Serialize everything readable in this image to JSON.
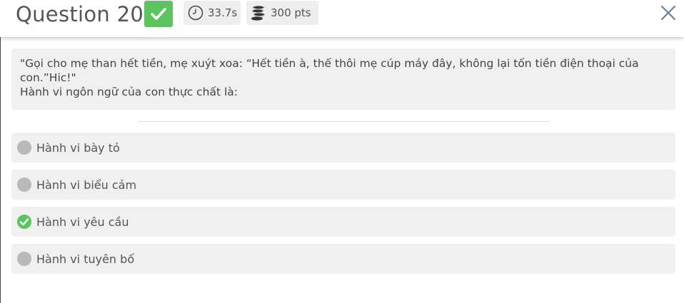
{
  "header": {
    "title": "Question 20",
    "timer": "33.7s",
    "points": "300 pts",
    "icons": {
      "status": "check-icon",
      "timer": "clock-icon",
      "points": "coins-icon",
      "close": "close-icon"
    },
    "accent_color": "#5cc45f"
  },
  "question": {
    "line1": "\"Gọi cho mẹ than hết tiền, mẹ xuýt xoa: “Hết tiền à, thế thôi mẹ cúp máy đây, không lại tốn tiền điện thoại của con.”Hic!\"",
    "line2": "Hành vi ngôn ngữ của con thực chất là:"
  },
  "answers": [
    {
      "label": "Hành vi bày tỏ",
      "selected": false
    },
    {
      "label": "Hành vi biểu cảm",
      "selected": false
    },
    {
      "label": "Hành vi yêu cầu",
      "selected": true
    },
    {
      "label": "Hành vi tuyên bố",
      "selected": false
    }
  ]
}
